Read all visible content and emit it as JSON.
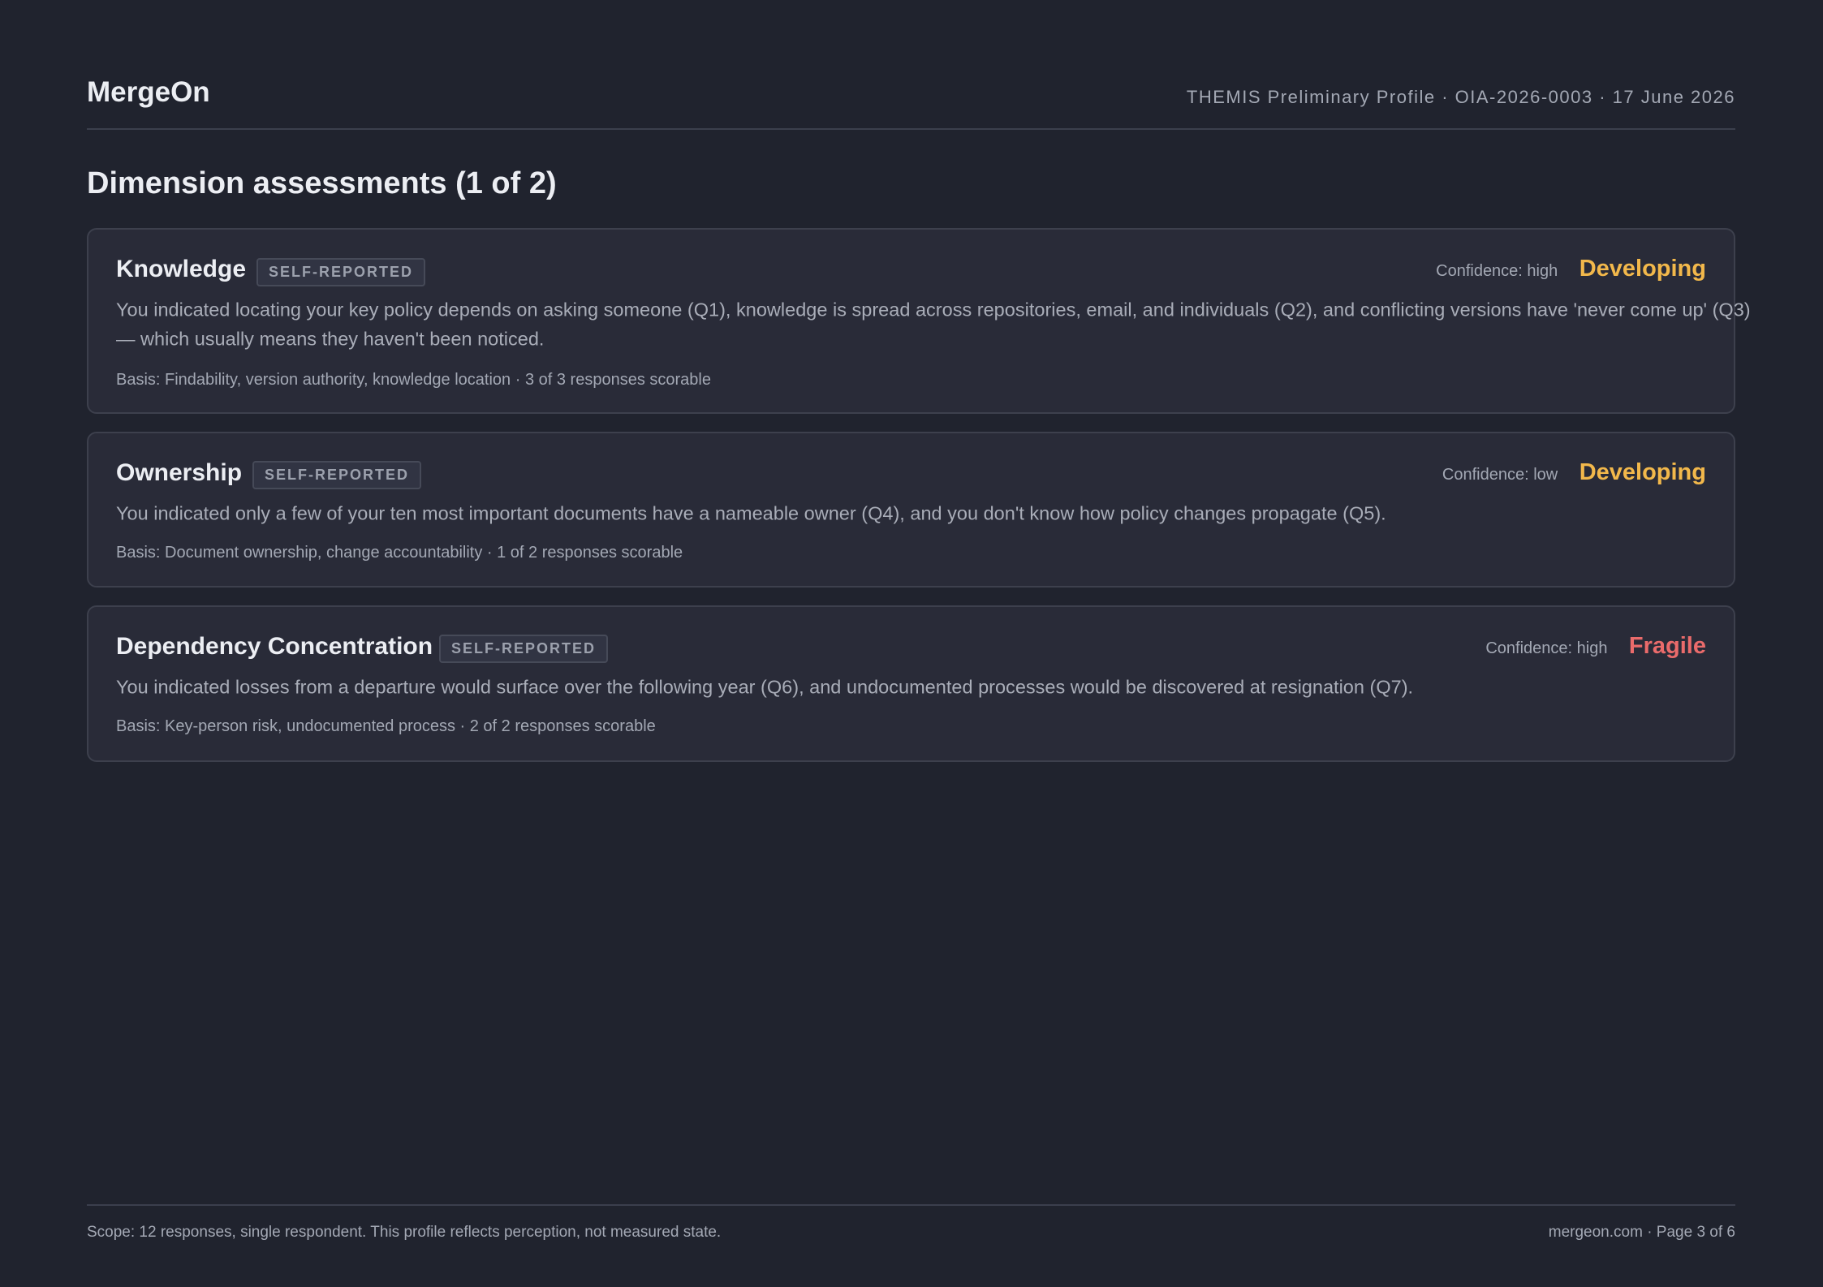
{
  "header": {
    "brand": "MergeOn",
    "doc_meta": "THEMIS Preliminary Profile · OIA-2026-0003 · 17 June 2026"
  },
  "section": {
    "title": "Dimension assessments (1 of 2)"
  },
  "cards": [
    {
      "name": "Knowledge",
      "tag": "SELF-REPORTED",
      "confidence": "Confidence: high",
      "rating": "Developing",
      "rating_color": "#f2b84b",
      "text": "You indicated locating your key policy depends on asking someone (Q1), knowledge is spread across repositories, email, and individuals (Q2), and conflicting versions have 'never come up' (Q3) — which usually means they haven't been noticed.",
      "basis": "Basis: Findability, version authority, knowledge location · 3 of 3 responses scorable"
    },
    {
      "name": "Ownership",
      "tag": "SELF-REPORTED",
      "confidence": "Confidence: low",
      "rating": "Developing",
      "rating_color": "#f2b84b",
      "text": "You indicated only a few of your ten most important documents have a nameable owner (Q4), and you don't know how policy changes propagate (Q5).",
      "basis": "Basis: Document ownership, change accountability · 1 of 2 responses scorable"
    },
    {
      "name": "Dependency Concentration",
      "tag": "SELF-REPORTED",
      "confidence": "Confidence: high",
      "rating": "Fragile",
      "rating_color": "#ea6b6b",
      "text": "You indicated losses from a departure would surface over the following year (Q6), and undocumented processes would be discovered at resignation (Q7).",
      "basis": "Basis: Key-person risk, undocumented process · 2 of 2 responses scorable"
    }
  ],
  "footer": {
    "scope": "Scope: 12 responses, single respondent. This profile reflects perception, not measured state.",
    "page_info": "mergeon.com · Page 3 of 6"
  }
}
